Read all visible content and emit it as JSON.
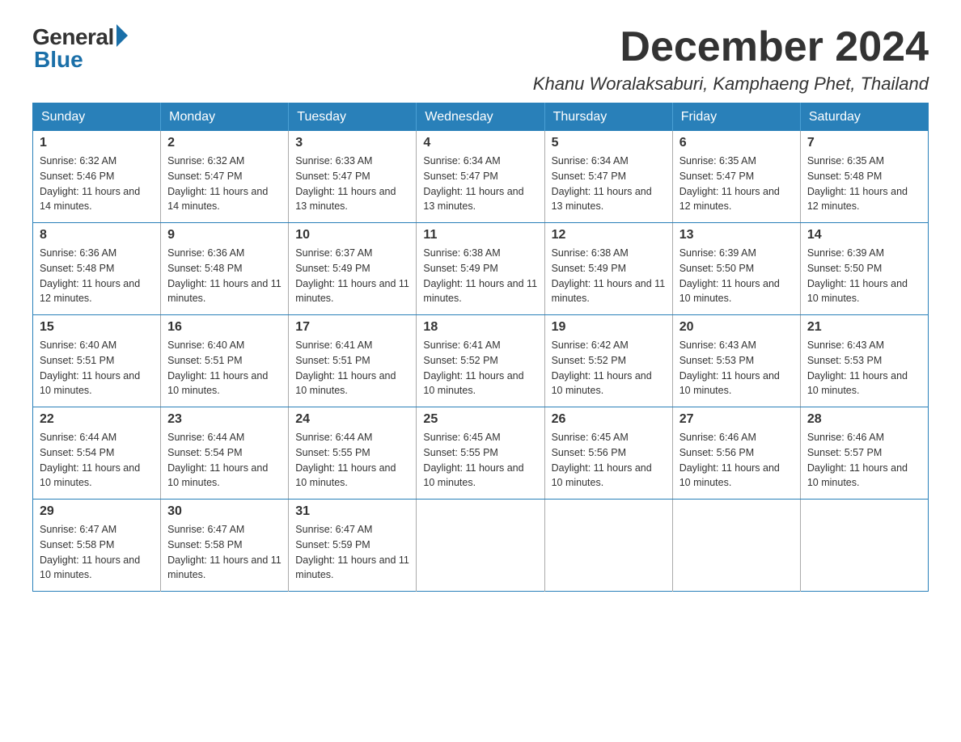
{
  "logo": {
    "general": "General",
    "blue": "Blue"
  },
  "header": {
    "month_year": "December 2024",
    "location": "Khanu Woralaksaburi, Kamphaeng Phet, Thailand"
  },
  "weekdays": [
    "Sunday",
    "Monday",
    "Tuesday",
    "Wednesday",
    "Thursday",
    "Friday",
    "Saturday"
  ],
  "weeks": [
    [
      {
        "day": "1",
        "sunrise": "6:32 AM",
        "sunset": "5:46 PM",
        "daylight": "11 hours and 14 minutes."
      },
      {
        "day": "2",
        "sunrise": "6:32 AM",
        "sunset": "5:47 PM",
        "daylight": "11 hours and 14 minutes."
      },
      {
        "day": "3",
        "sunrise": "6:33 AM",
        "sunset": "5:47 PM",
        "daylight": "11 hours and 13 minutes."
      },
      {
        "day": "4",
        "sunrise": "6:34 AM",
        "sunset": "5:47 PM",
        "daylight": "11 hours and 13 minutes."
      },
      {
        "day": "5",
        "sunrise": "6:34 AM",
        "sunset": "5:47 PM",
        "daylight": "11 hours and 13 minutes."
      },
      {
        "day": "6",
        "sunrise": "6:35 AM",
        "sunset": "5:47 PM",
        "daylight": "11 hours and 12 minutes."
      },
      {
        "day": "7",
        "sunrise": "6:35 AM",
        "sunset": "5:48 PM",
        "daylight": "11 hours and 12 minutes."
      }
    ],
    [
      {
        "day": "8",
        "sunrise": "6:36 AM",
        "sunset": "5:48 PM",
        "daylight": "11 hours and 12 minutes."
      },
      {
        "day": "9",
        "sunrise": "6:36 AM",
        "sunset": "5:48 PM",
        "daylight": "11 hours and 11 minutes."
      },
      {
        "day": "10",
        "sunrise": "6:37 AM",
        "sunset": "5:49 PM",
        "daylight": "11 hours and 11 minutes."
      },
      {
        "day": "11",
        "sunrise": "6:38 AM",
        "sunset": "5:49 PM",
        "daylight": "11 hours and 11 minutes."
      },
      {
        "day": "12",
        "sunrise": "6:38 AM",
        "sunset": "5:49 PM",
        "daylight": "11 hours and 11 minutes."
      },
      {
        "day": "13",
        "sunrise": "6:39 AM",
        "sunset": "5:50 PM",
        "daylight": "11 hours and 10 minutes."
      },
      {
        "day": "14",
        "sunrise": "6:39 AM",
        "sunset": "5:50 PM",
        "daylight": "11 hours and 10 minutes."
      }
    ],
    [
      {
        "day": "15",
        "sunrise": "6:40 AM",
        "sunset": "5:51 PM",
        "daylight": "11 hours and 10 minutes."
      },
      {
        "day": "16",
        "sunrise": "6:40 AM",
        "sunset": "5:51 PM",
        "daylight": "11 hours and 10 minutes."
      },
      {
        "day": "17",
        "sunrise": "6:41 AM",
        "sunset": "5:51 PM",
        "daylight": "11 hours and 10 minutes."
      },
      {
        "day": "18",
        "sunrise": "6:41 AM",
        "sunset": "5:52 PM",
        "daylight": "11 hours and 10 minutes."
      },
      {
        "day": "19",
        "sunrise": "6:42 AM",
        "sunset": "5:52 PM",
        "daylight": "11 hours and 10 minutes."
      },
      {
        "day": "20",
        "sunrise": "6:43 AM",
        "sunset": "5:53 PM",
        "daylight": "11 hours and 10 minutes."
      },
      {
        "day": "21",
        "sunrise": "6:43 AM",
        "sunset": "5:53 PM",
        "daylight": "11 hours and 10 minutes."
      }
    ],
    [
      {
        "day": "22",
        "sunrise": "6:44 AM",
        "sunset": "5:54 PM",
        "daylight": "11 hours and 10 minutes."
      },
      {
        "day": "23",
        "sunrise": "6:44 AM",
        "sunset": "5:54 PM",
        "daylight": "11 hours and 10 minutes."
      },
      {
        "day": "24",
        "sunrise": "6:44 AM",
        "sunset": "5:55 PM",
        "daylight": "11 hours and 10 minutes."
      },
      {
        "day": "25",
        "sunrise": "6:45 AM",
        "sunset": "5:55 PM",
        "daylight": "11 hours and 10 minutes."
      },
      {
        "day": "26",
        "sunrise": "6:45 AM",
        "sunset": "5:56 PM",
        "daylight": "11 hours and 10 minutes."
      },
      {
        "day": "27",
        "sunrise": "6:46 AM",
        "sunset": "5:56 PM",
        "daylight": "11 hours and 10 minutes."
      },
      {
        "day": "28",
        "sunrise": "6:46 AM",
        "sunset": "5:57 PM",
        "daylight": "11 hours and 10 minutes."
      }
    ],
    [
      {
        "day": "29",
        "sunrise": "6:47 AM",
        "sunset": "5:58 PM",
        "daylight": "11 hours and 10 minutes."
      },
      {
        "day": "30",
        "sunrise": "6:47 AM",
        "sunset": "5:58 PM",
        "daylight": "11 hours and 11 minutes."
      },
      {
        "day": "31",
        "sunrise": "6:47 AM",
        "sunset": "5:59 PM",
        "daylight": "11 hours and 11 minutes."
      },
      null,
      null,
      null,
      null
    ]
  ]
}
